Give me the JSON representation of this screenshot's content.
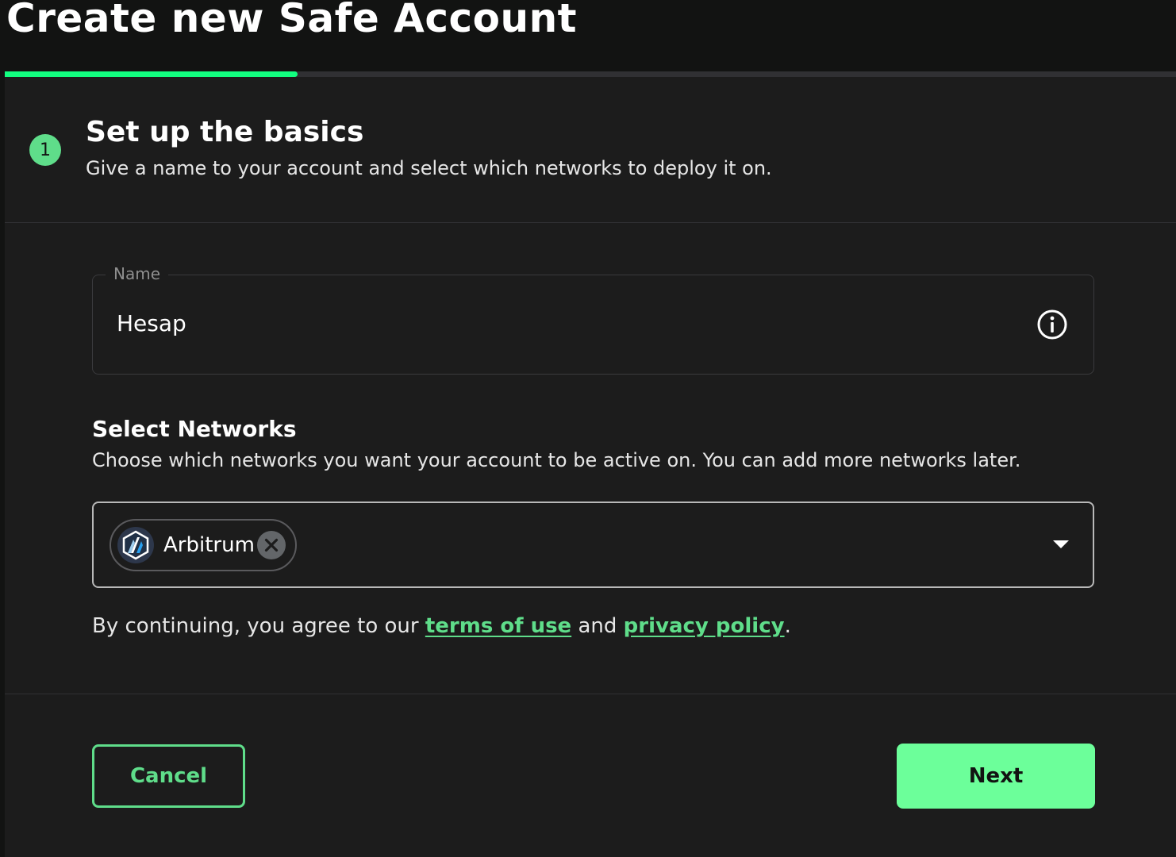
{
  "page": {
    "title": "Create new Safe Account"
  },
  "progress": {
    "value_percent": 25
  },
  "step": {
    "number": "1",
    "title": "Set up the basics",
    "subtitle": "Give a name to your account and select which networks to deploy it on."
  },
  "name_field": {
    "label": "Name",
    "value": "Hesap",
    "icon": "info-icon"
  },
  "networks": {
    "title": "Select Networks",
    "description": "Choose which networks you want your account to be active on. You can add more networks later.",
    "selected": [
      {
        "label": "Arbitrum",
        "icon": "arbitrum-logo-icon"
      }
    ]
  },
  "terms": {
    "prefix": "By continuing, you agree to our ",
    "terms_link": "terms of use",
    "middle": " and ",
    "privacy_link": "privacy policy",
    "suffix": "."
  },
  "actions": {
    "cancel_label": "Cancel",
    "next_label": "Next"
  },
  "colors": {
    "accent": "#12ff80",
    "badge": "#5fdd8a",
    "background": "#121312",
    "card": "#1c1c1c"
  }
}
